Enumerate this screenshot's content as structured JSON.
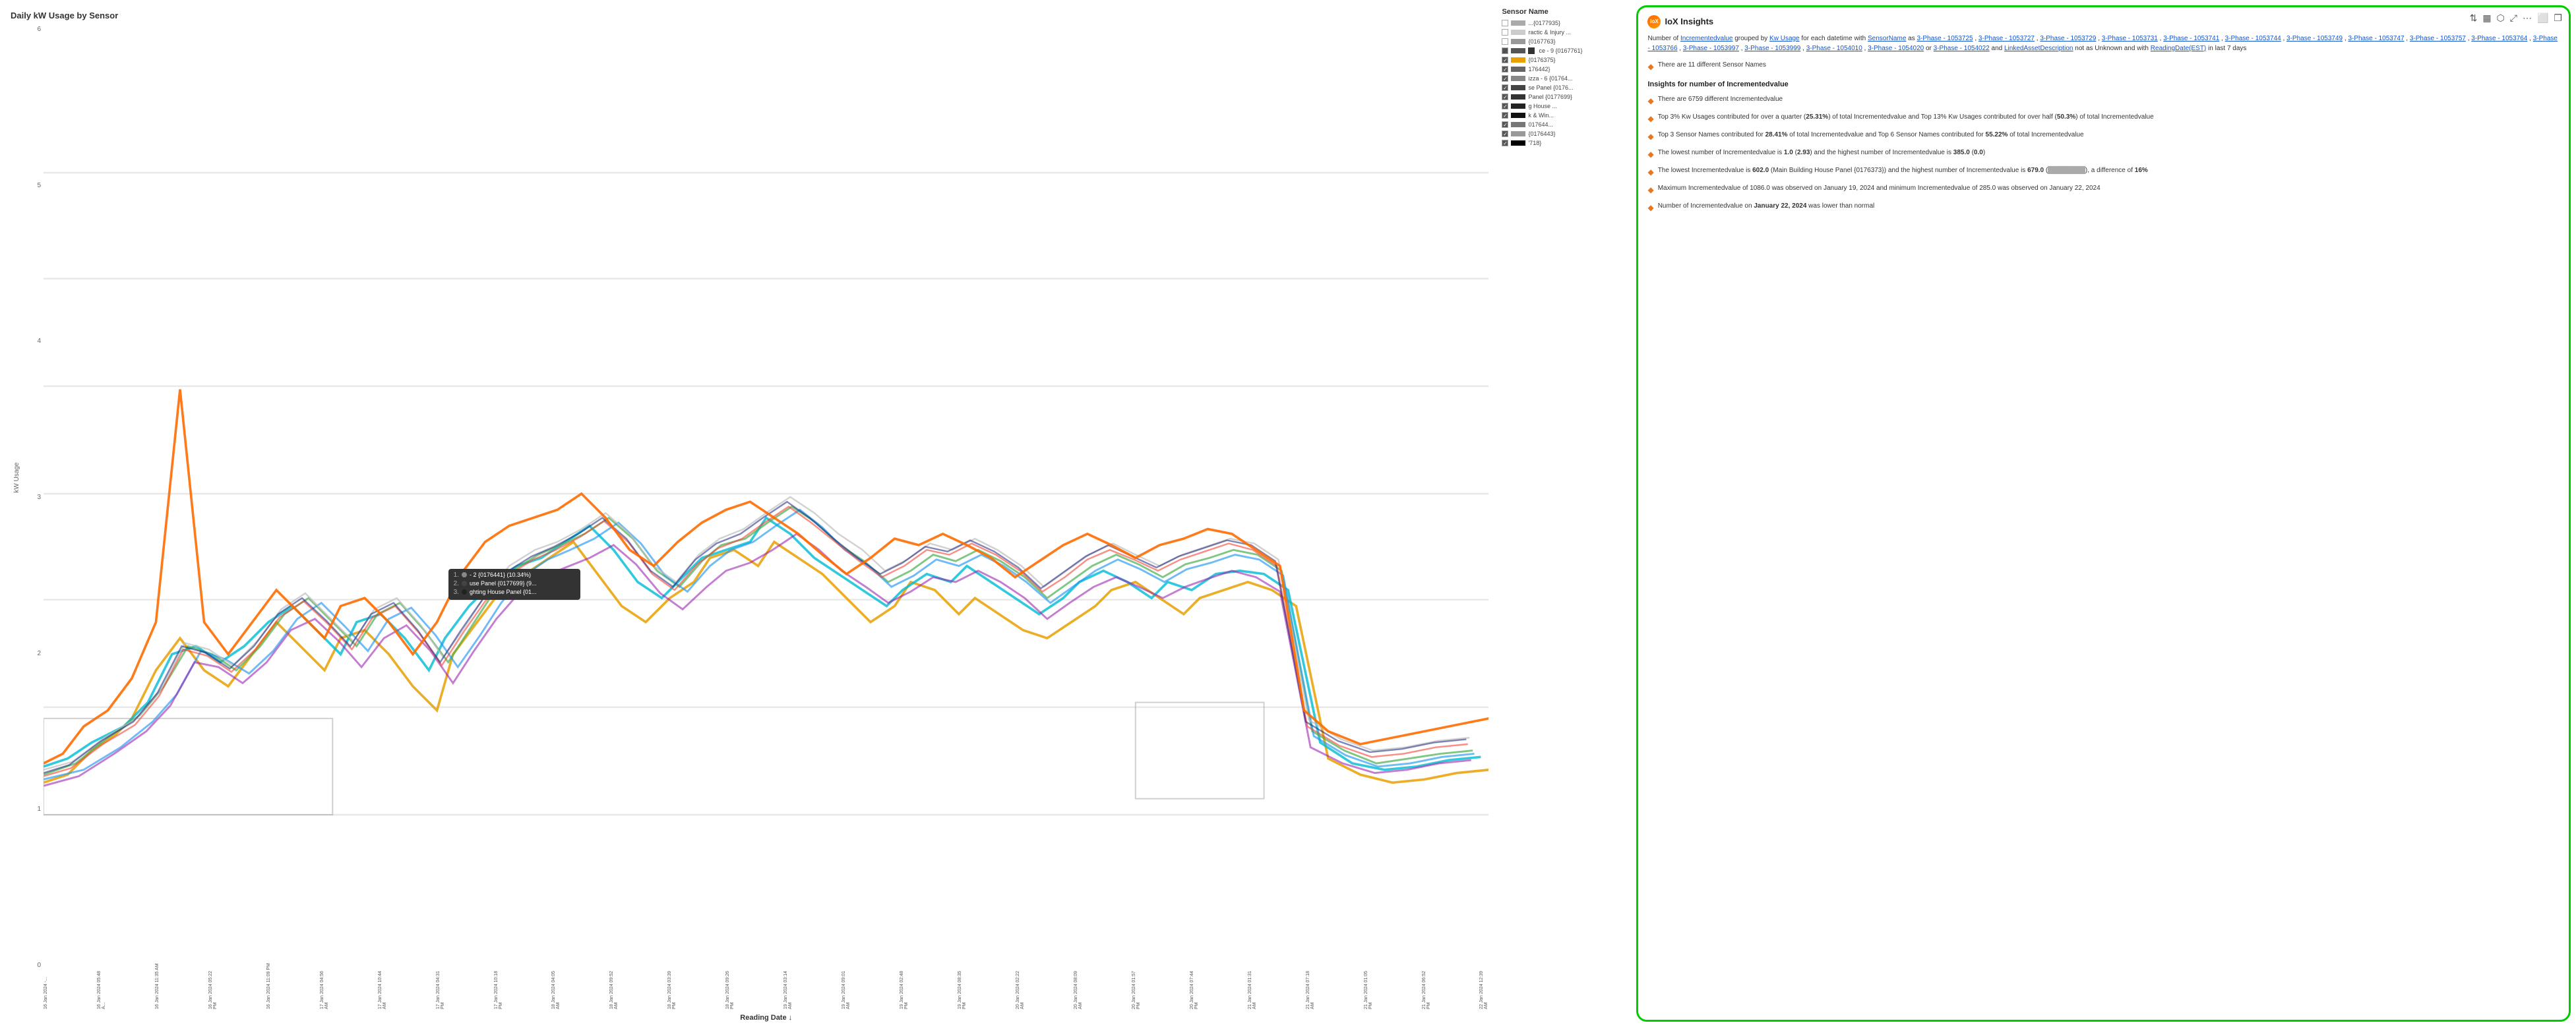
{
  "chart": {
    "title": "Daily kW Usage by Sensor",
    "y_axis_label": "kW Usage",
    "x_axis_label": "Reading Date ↓",
    "y_ticks": [
      "6",
      "5",
      "4",
      "3",
      "2",
      "1",
      "0"
    ],
    "x_labels": [
      "16 Jan 2024 -...",
      "16 Jan 2024 05:48 A...",
      "16 Jan 2024 11:35 AM",
      "16 Jan 2024 05:22 PM",
      "16 Jan 2024 11:09 PM",
      "17 Jan 2024 04:56 AM",
      "17 Jan 2024 10:44 AM",
      "17 Jan 2024 04:31 PM",
      "17 Jan 2024 10:18 PM",
      "18 Jan 2024 04:05 AM",
      "18 Jan 2024 09:52 AM",
      "18 Jan 2024 03:39 PM",
      "18 Jan 2024 09:26 PM",
      "19 Jan 2024 03:14 AM",
      "19 Jan 2024 09:01 AM",
      "19 Jan 2024 02:48 PM",
      "19 Jan 2024 08:35 PM",
      "20 Jan 2024 02:22 AM",
      "20 Jan 2024 08:09 AM",
      "20 Jan 2024 01:57 PM",
      "20 Jan 2024 07:44 PM",
      "21 Jan 2024 01:31 AM",
      "21 Jan 2024 07:18 AM",
      "21 Jan 2024 01:05 PM",
      "21 Jan 2024 06:52 PM",
      "22 Jan 2024 12:39 AM"
    ]
  },
  "legend": {
    "header": "Sensor Name",
    "items": [
      {
        "color": "#aaaaaa",
        "text": "...{0177935}",
        "checked": false
      },
      {
        "color": "#cccccc",
        "text": "ractic & Injury ...",
        "checked": false
      },
      {
        "color": "#999999",
        "text": "{0167763}",
        "checked": false
      },
      {
        "color": "#555555",
        "text": "ce - 9 {0167761}",
        "checked": true,
        "has_square": true
      },
      {
        "color": "#e8a000",
        "text": "{0176375}",
        "checked": true
      },
      {
        "color": "#666666",
        "text": "176442}",
        "checked": true
      },
      {
        "color": "#888888",
        "text": "izza - 6 {01764...",
        "checked": true
      },
      {
        "color": "#444444",
        "text": "se Panel {0176...",
        "checked": true
      },
      {
        "color": "#333333",
        "text": "Panel {0177699}",
        "checked": true
      },
      {
        "color": "#222222",
        "text": "g House ...",
        "checked": true
      },
      {
        "color": "#111111",
        "text": "k & Win...",
        "checked": true
      },
      {
        "color": "#777777",
        "text": "017644...",
        "checked": true
      },
      {
        "color": "#999999",
        "text": "{0176443}",
        "checked": true
      },
      {
        "color": "#000000",
        "text": "'718}",
        "checked": true
      }
    ]
  },
  "tooltip": {
    "items": [
      {
        "rank": "1.",
        "color": "#888888",
        "text": "- 2 {0176441} (10.34%)"
      },
      {
        "rank": "2.",
        "color": "#444444",
        "text": "use Panel {0177699} (9..."
      },
      {
        "rank": "3.",
        "color": "#222222",
        "text": "ghting House Panel {01..."
      }
    ]
  },
  "insights": {
    "logo_text": "IoX",
    "title": "IoX Insights",
    "query_text": "Number of Incrementedvalue grouped by Kw Usage for each datetime with SensorName as 3-Phase - 1053725 , 3-Phase - 1053727 , 3-Phase - 1053729 , 3-Phase - 1053731 , 3-Phase - 1053741 , 3-Phase - 1053744 , 3-Phase - 1053749 , 3-Phase - 1053747 , 3-Phase - 1053757 , 3-Phase - 1053764 , 3-Phase - 1053766 , 3-Phase - 1053997 , 3-Phase - 1053999 , 3-Phase - 1054010 , 3-Phase - 1054020 or 3-Phase - 1054022 and LinkedAssetDescription not as Unknown and with ReadingDate(EST) in last 7 days",
    "stat_different": "There are 11 different Sensor Names",
    "section_title": "Insights for number of Incrementedvalue",
    "bullet1": "There are 6759 different Incrementedvalue",
    "bullet2_prefix": "Top 3% Kw Usages contributed for over a quarter (",
    "bullet2_bold": "25.31%",
    "bullet2_mid": ") of total Incrementedvalue and ",
    "bullet2_link": "Top 13%",
    "bullet2_suffix": " Kw Usages contributed for over half (",
    "bullet2_bold2": "50.3%",
    "bullet2_end": ") of total Incrementedvalue",
    "bullet3_prefix": "Top 3",
    "bullet3_link1": "Top 3",
    "bullet3_text": " Sensor Names contributed for 28.41% of total Incrementedvalue and ",
    "bullet3_link2": "Top 6",
    "bullet3_text2": " Sensor Names contributed for 55.22% of total Incrementedvalue",
    "bullet4": "The lowest number of Incrementedvalue is 1.0 (2.93) and the highest number of Incrementedvalue is 385.0 (0.0)",
    "bullet5_prefix": "The lowest Incrementedvalue is 602.0 (",
    "bullet5_link": "Main Building House Panel {0176373}",
    "bullet5_mid": ") and the highest number of Incrementedvalue is 679.0 (",
    "bullet5_end": "), a difference of 16%",
    "bullet6": "Maximum Incrementedvalue of 1086.0 was observed on January 19, 2024 and minimum Incrementedvalue of 285.0 was observed on January 22, 2024",
    "bullet7_prefix": "Number of Incrementedvalue on ",
    "bullet7_link": "January 22, 2024",
    "bullet7_suffix": " was lower than normal"
  },
  "toolbar_icons": {
    "sort": "⇅",
    "bar_chart": "▦",
    "share": "⬡",
    "expand": "⤢",
    "more": "⋯",
    "window": "⬜",
    "copy": "❐"
  }
}
